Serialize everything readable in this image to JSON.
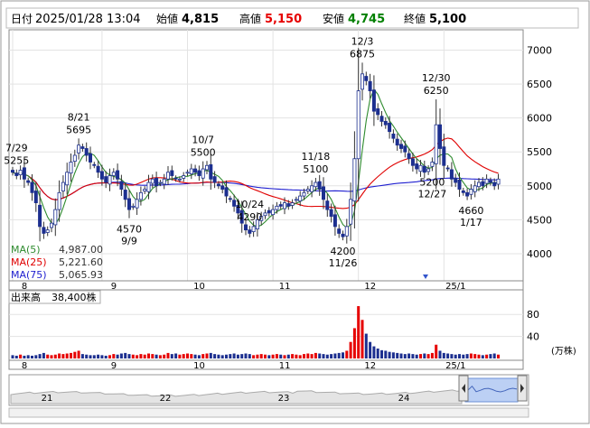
{
  "header": {
    "date_label": "日付",
    "date_value": "2025/01/28 13:04",
    "open_label": "始値",
    "open_value": "4,815",
    "high_label": "高値",
    "high_value": "5,150",
    "low_label": "安値",
    "low_value": "4,745",
    "close_label": "終値",
    "close_value": "5,100",
    "colors": {
      "high": "#e60000",
      "low": "#008000",
      "text": "#000000"
    }
  },
  "legend": [
    {
      "label": "MA(5)",
      "value": "4,987.00",
      "color": "#2e8b2e"
    },
    {
      "label": "MA(25)",
      "value": "5,221.60",
      "color": "#e00000"
    },
    {
      "label": "MA(75)",
      "value": "5,065.93",
      "color": "#2020d0"
    }
  ],
  "volume_header": {
    "label": "出来高",
    "value": "38,400株"
  },
  "volume_unit": "(万株)",
  "chart_data": {
    "type": "candlestick",
    "price_axis": {
      "ticks": [
        4000,
        4500,
        5000,
        5500,
        6000,
        6500,
        7000
      ],
      "ylim": [
        3600,
        7300
      ]
    },
    "month_labels": [
      "8",
      "9",
      "10",
      "11",
      "12",
      "25/1"
    ],
    "month_start_index": [
      0,
      23,
      45,
      67,
      89,
      111
    ],
    "volume_axis": {
      "ticks": [
        40,
        80
      ],
      "ylim": [
        0,
        100
      ]
    },
    "annotations": [
      {
        "date": "7/29",
        "price": "5255",
        "index": 1
      },
      {
        "date": "8/21",
        "price": "5695",
        "index": 17
      },
      {
        "date": "9/9",
        "price": "4570",
        "index": 30
      },
      {
        "date": "10/7",
        "price": "5500",
        "index": 49
      },
      {
        "date": "10/24",
        "price": "4290",
        "index": 61
      },
      {
        "date": "11/18",
        "price": "5100",
        "index": 78
      },
      {
        "date": "11/26",
        "price": "4200",
        "index": 85
      },
      {
        "date": "12/3",
        "price": "6875",
        "index": 90
      },
      {
        "date": "12/30",
        "price": "6250",
        "index": 109
      },
      {
        "date": "12/27",
        "price": "5200",
        "index": 108
      },
      {
        "date": "1/17",
        "price": "4660",
        "index": 118
      }
    ],
    "close": [
      5200,
      5150,
      5230,
      5100,
      5050,
      4900,
      4750,
      4400,
      4300,
      4350,
      4450,
      4650,
      4900,
      5050,
      5200,
      5350,
      5450,
      5600,
      5550,
      5450,
      5350,
      5300,
      5200,
      5100,
      5050,
      5150,
      5200,
      5100,
      4950,
      4800,
      4650,
      4700,
      4800,
      4900,
      4950,
      5050,
      5100,
      5000,
      5050,
      5100,
      5200,
      5150,
      5100,
      5100,
      5150,
      5200,
      5250,
      5200,
      5150,
      5250,
      5300,
      5100,
      5050,
      5000,
      4950,
      4850,
      4800,
      4700,
      4600,
      4450,
      4350,
      4300,
      4400,
      4500,
      4550,
      4600,
      4600,
      4650,
      4700,
      4700,
      4750,
      4700,
      4750,
      4800,
      4850,
      4900,
      4950,
      5000,
      5050,
      4950,
      4800,
      4650,
      4550,
      4400,
      4300,
      4250,
      4400,
      4800,
      5400,
      6400,
      6650,
      6550,
      6400,
      6100,
      6050,
      5950,
      5900,
      5800,
      5700,
      5600,
      5550,
      5500,
      5400,
      5300,
      5250,
      5300,
      5200,
      5250,
      5350,
      5900,
      5550,
      5300,
      5250,
      5100,
      5050,
      4950,
      4900,
      4850,
      4950,
      5000,
      5050,
      5000,
      5100,
      5050,
      5000,
      5100
    ],
    "volume": [
      6,
      5,
      7,
      5,
      6,
      5,
      6,
      8,
      10,
      7,
      6,
      7,
      9,
      8,
      9,
      10,
      12,
      14,
      8,
      7,
      6,
      6,
      7,
      6,
      5,
      6,
      8,
      7,
      9,
      10,
      8,
      7,
      6,
      8,
      7,
      9,
      8,
      7,
      6,
      7,
      10,
      8,
      9,
      7,
      8,
      9,
      8,
      7,
      6,
      8,
      9,
      10,
      8,
      7,
      6,
      7,
      8,
      9,
      7,
      8,
      9,
      8,
      6,
      7,
      8,
      7,
      6,
      7,
      8,
      7,
      6,
      7,
      8,
      7,
      6,
      8,
      9,
      8,
      10,
      9,
      8,
      7,
      8,
      9,
      10,
      11,
      14,
      30,
      55,
      95,
      70,
      45,
      30,
      22,
      18,
      15,
      14,
      12,
      11,
      10,
      9,
      8,
      9,
      8,
      7,
      8,
      9,
      8,
      10,
      25,
      14,
      10,
      9,
      8,
      7,
      8,
      7,
      8,
      9,
      8,
      7,
      6,
      7,
      8,
      9,
      7
    ],
    "ma5": {
      "name": "MA(5)",
      "value": "4,987.00"
    },
    "ma25": {
      "name": "MA(25)",
      "value": "5,221.60"
    },
    "ma75": {
      "name": "MA(75)",
      "value": "5,065.93"
    },
    "navigator": {
      "labels": [
        "21",
        "22",
        "23",
        "24"
      ]
    }
  }
}
